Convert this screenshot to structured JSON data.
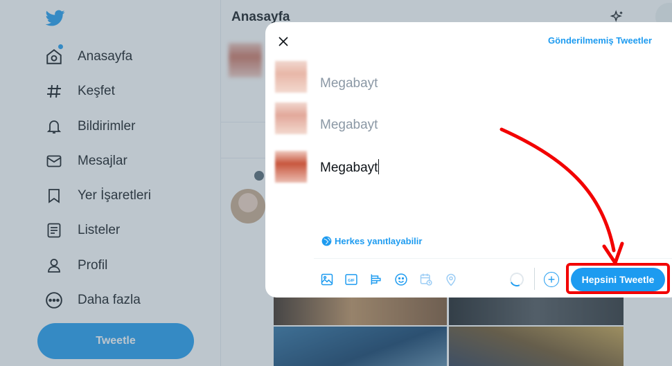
{
  "sidebar": {
    "items": [
      {
        "label": "Anasayfa",
        "icon": "home-icon"
      },
      {
        "label": "Keşfet",
        "icon": "hashtag-icon"
      },
      {
        "label": "Bildirimler",
        "icon": "bell-icon"
      },
      {
        "label": "Mesajlar",
        "icon": "mail-icon"
      },
      {
        "label": "Yer İşaretleri",
        "icon": "bookmark-icon"
      },
      {
        "label": "Listeler",
        "icon": "list-icon"
      },
      {
        "label": "Profil",
        "icon": "person-icon"
      },
      {
        "label": "Daha fazla",
        "icon": "more-icon"
      }
    ],
    "tweet_button": "Tweetle"
  },
  "feed": {
    "title": "Anasayfa"
  },
  "modal": {
    "unsent_link": "Gönderilmemiş Tweetler",
    "tweets": [
      "Megabayt",
      "Megabayt",
      "Megabayt"
    ],
    "reply_setting": "Herkes yanıtlayabilir",
    "tweet_all_button": "Hepsini Tweetle",
    "toolbar_icons": [
      "image-icon",
      "gif-icon",
      "poll-icon",
      "emoji-icon",
      "schedule-icon",
      "location-icon"
    ]
  },
  "colors": {
    "accent": "#1d9bf0",
    "annotation": "#f20000"
  }
}
